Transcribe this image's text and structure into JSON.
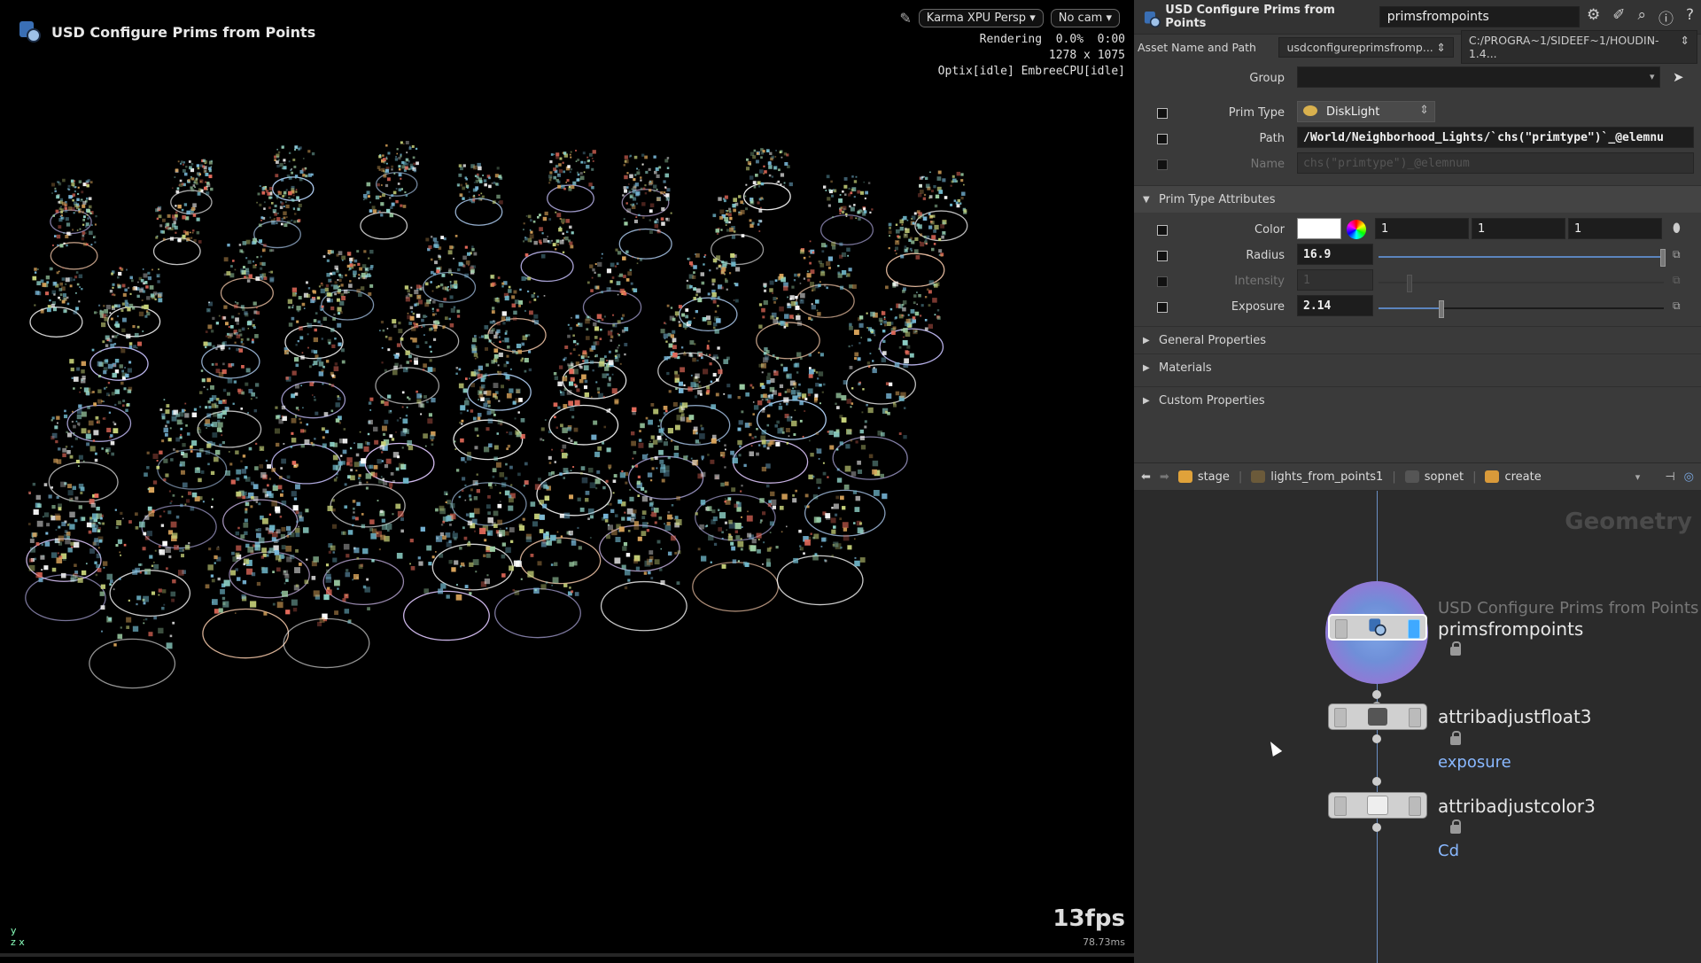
{
  "viewport": {
    "title": "USD Configure Prims from Points",
    "renderer_button": "Karma XPU Persp",
    "camera_button": "No cam",
    "stats_line1": "Rendering  0.0%  0:00",
    "stats_line2": "1278 x 1075",
    "stats_line3": "Optix[idle] EmbreeCPU[idle]",
    "fps": "13fps",
    "frame_time": "78.73ms",
    "axis_label": "y\nz x"
  },
  "params": {
    "node_type": "USD Configure Prims from Points",
    "node_name": "primsfrompoints",
    "asset_label": "Asset Name and Path",
    "asset_name": "usdconfigureprimsfromp...",
    "asset_path": "C:/PROGRA~1/SIDEEF~1/HOUDIN-1.4...",
    "group_label": "Group",
    "group_value": "",
    "prim_type_label": "Prim Type",
    "prim_type_value": "DiskLight",
    "path_label": "Path",
    "path_value": "/World/Neighborhood_Lights/`chs(\"primtype\")`_@elemnu",
    "name_label": "Name",
    "name_value": "chs(\"primtype\")_@elemnum",
    "section_prim_type": "Prim Type Attributes",
    "color_label": "Color",
    "color_r": "1",
    "color_g": "1",
    "color_b": "1",
    "radius_label": "Radius",
    "radius_value": "16.9",
    "radius_fraction": 1.0,
    "intensity_label": "Intensity",
    "intensity_value": "1",
    "exposure_label": "Exposure",
    "exposure_value": "2.14",
    "exposure_fraction": 0.21,
    "section_general": "General Properties",
    "section_materials": "Materials",
    "section_custom": "Custom Properties"
  },
  "network": {
    "crumbs": [
      "stage",
      "lights_from_points1",
      "sopnet",
      "create"
    ],
    "context_label": "Geometry",
    "node1_type": "USD Configure Prims from Points",
    "node1_name": "primsfrompoints",
    "node2_name": "attribadjustfloat3",
    "node2_attr": "exposure",
    "node3_name": "attribadjustcolor3",
    "node3_attr": "Cd"
  },
  "colors": {
    "accent": "#5b84bd",
    "wire": "#6a8fc4",
    "attr_label": "#89b8ff",
    "selected_ring": "#8f7ad6"
  }
}
